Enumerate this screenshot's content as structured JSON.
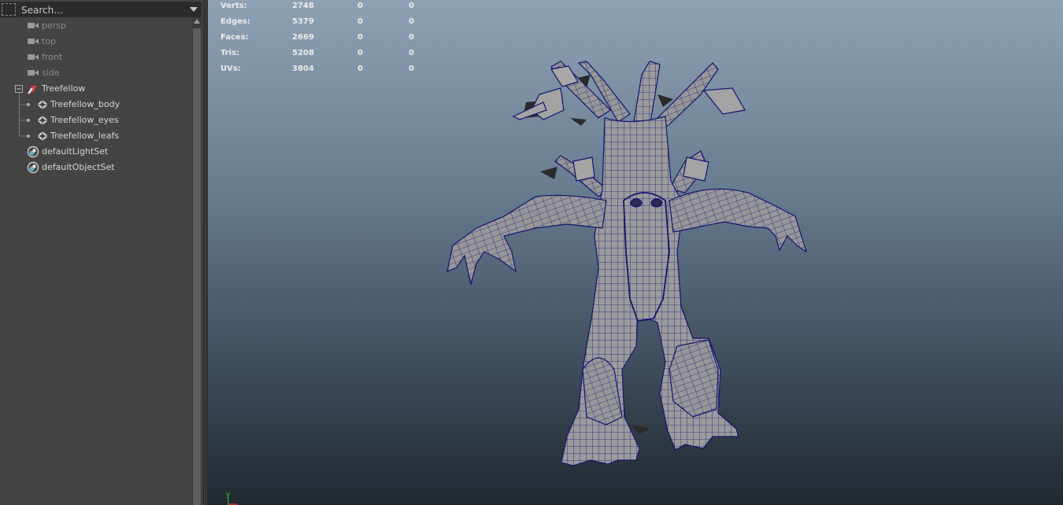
{
  "outliner": {
    "search": {
      "placeholder": "Search..."
    },
    "items": [
      {
        "label": "persp",
        "type": "camera",
        "dimmed": true
      },
      {
        "label": "top",
        "type": "camera",
        "dimmed": true
      },
      {
        "label": "front",
        "type": "camera",
        "dimmed": true
      },
      {
        "label": "side",
        "type": "camera",
        "dimmed": true
      },
      {
        "label": "Treefellow",
        "type": "group",
        "expanded": true
      },
      {
        "label": "Treefellow_body",
        "type": "mesh"
      },
      {
        "label": "Treefellow_eyes",
        "type": "mesh"
      },
      {
        "label": "Treefellow_leafs",
        "type": "mesh"
      },
      {
        "label": "defaultLightSet",
        "type": "set"
      },
      {
        "label": "defaultObjectSet",
        "type": "set"
      }
    ]
  },
  "viewport": {
    "hud": [
      {
        "label": "Verts:",
        "values": [
          "2748",
          "0",
          "0"
        ]
      },
      {
        "label": "Edges:",
        "values": [
          "5379",
          "0",
          "0"
        ]
      },
      {
        "label": "Faces:",
        "values": [
          "2669",
          "0",
          "0"
        ]
      },
      {
        "label": "Tris:",
        "values": [
          "5208",
          "0",
          "0"
        ]
      },
      {
        "label": "UVs:",
        "values": [
          "3804",
          "0",
          "0"
        ]
      }
    ],
    "axis_label": "y",
    "colors": {
      "wireframe": "#1a1a8a",
      "mesh": "#9c9c9c",
      "gradient_top": "#8fa1b5",
      "gradient_bottom": "#212830"
    }
  }
}
